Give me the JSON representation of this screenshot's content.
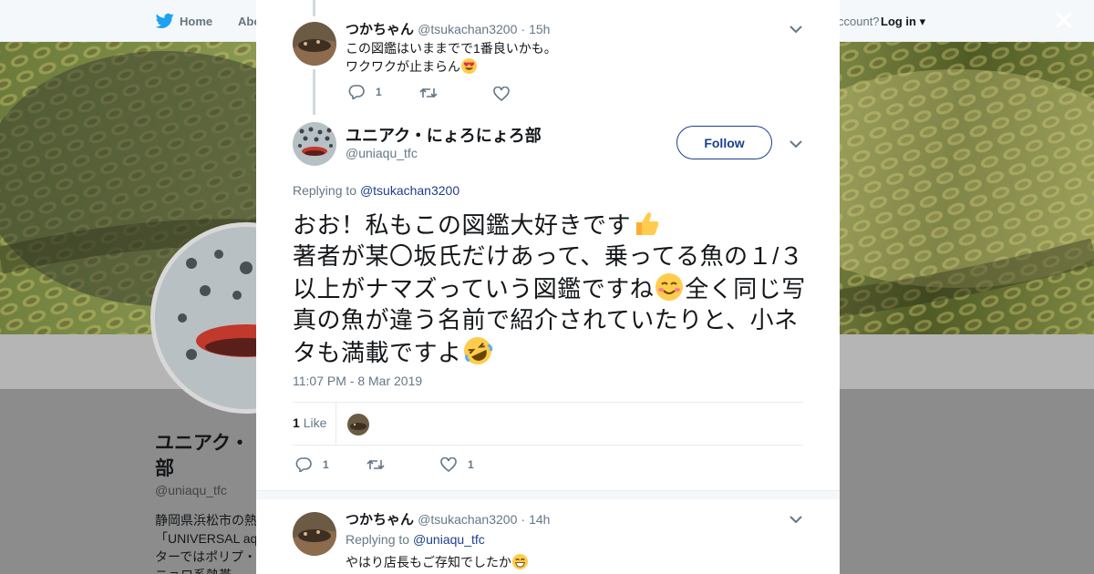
{
  "topbar": {
    "home_label": "Home",
    "about_label": "Abo",
    "account_prompt": "ccount?",
    "login_label": "Log in"
  },
  "profile": {
    "name": "ユニアク・にょろにょろ部",
    "name_visible_part1": "ユニアク・",
    "name_visible_part2": "部",
    "handle": "@uniaqu_tfc",
    "bio_lines": [
      "静岡県浜松市の熱",
      "「UNIVERSAL aq",
      "ターではポリプ・",
      "ニョロ系熱帯"
    ]
  },
  "parent_tweet": {
    "name": "つかちゃん",
    "handle": "@tsukachan3200",
    "time": "· 15h",
    "line1": "この図鑑はいままでで1番良いかも。",
    "line2": "ワクワクが止まらん",
    "reply_count": "1"
  },
  "main_tweet": {
    "name": "ユニアク・にょろにょろ部",
    "handle": "@uniaqu_tfc",
    "follow_label": "Follow",
    "replying_label": "Replying to",
    "replying_handle": "@tsukachan3200",
    "text_1": "おお！私もこの図鑑大好きです",
    "text_2": "著者が某〇坂氏だけあって、乗ってる魚の１/３以上がナマズっていう図鑑ですね",
    "text_3": "全く同じ写真の魚が違う名前で紹介されていたりと、小ネタも満載ですよ",
    "timestamp": "11:07 PM - 8 Mar 2019",
    "like_count": "1",
    "like_label": "Like",
    "reply_count": "1",
    "fav_count": "1"
  },
  "reply_tweet": {
    "name": "つかちゃん",
    "handle": "@tsukachan3200",
    "time": "· 14h",
    "replying_label": "Replying to",
    "replying_handle": "@uniaqu_tfc",
    "text": "やはり店長もご存知でしたか"
  },
  "colors": {
    "link": "#1c3f8c",
    "muted": "#657786",
    "twitter_blue": "#1da1f2"
  }
}
